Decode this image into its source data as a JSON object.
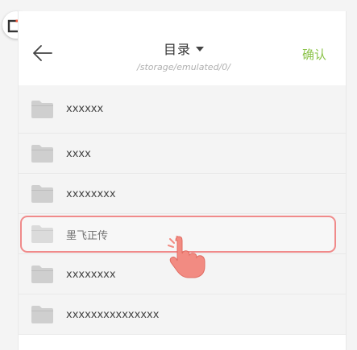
{
  "header": {
    "title": "目录",
    "path": "/storage/emulated/0/",
    "confirm_label": "确认"
  },
  "folders": [
    {
      "label": "xxxxxx"
    },
    {
      "label": "xxxx"
    },
    {
      "label": "xxxxxxxx"
    },
    {
      "label": "墨飞正传"
    },
    {
      "label": "xxxxxxxx"
    },
    {
      "label": "xxxxxxxxxxxxxxx"
    }
  ],
  "highlighted_folder_index": 3,
  "colors": {
    "accent": "#8bc34a",
    "highlight_border": "#f08a8a",
    "badge_red": "#f25a3c",
    "folder_icon": "#cfcfcf",
    "hand": "#f28b82"
  },
  "icons": {
    "back": "arrow-left-icon",
    "dropdown": "caret-down-icon",
    "folder": "folder-icon",
    "badge": "add-window-icon",
    "pointer": "tap-hand-icon"
  }
}
